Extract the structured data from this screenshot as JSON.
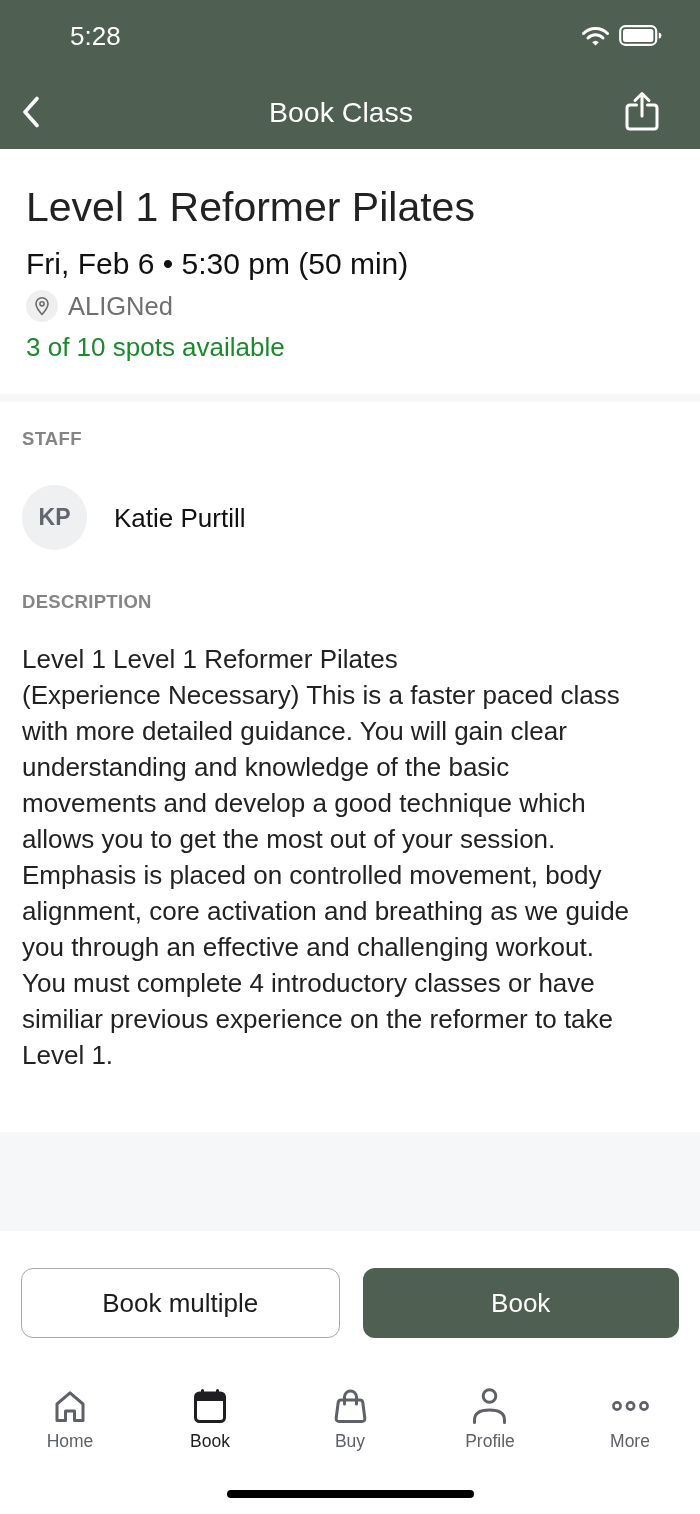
{
  "status_bar": {
    "time": "5:28"
  },
  "nav_bar": {
    "title": "Book Class"
  },
  "class_info": {
    "title": "Level 1 Reformer Pilates",
    "schedule": "Fri, Feb 6 • 5:30 pm (50 min)",
    "location": "ALIGNed",
    "availability": "3 of 10 spots available"
  },
  "staff": {
    "heading": "STAFF",
    "members": [
      {
        "initials": "KP",
        "name": "Katie Purtill"
      }
    ]
  },
  "description": {
    "heading": "DESCRIPTION",
    "text": "Level 1 Level 1 Reformer Pilates\n(Experience Necessary) This is a faster paced class with more detailed guidance. You will gain clear understanding and knowledge of the basic movements and develop a good technique which allows you to get the most out of your session. Emphasis is placed on controlled movement, body alignment, core activation and breathing as we guide you through an effective and challenging workout. You must complete 4 introductory classes or have similiar previous experience on the reformer to take Level 1."
  },
  "actions": [
    {
      "label": "Book multiple",
      "kind": "outline"
    },
    {
      "label": "Book",
      "kind": "primary"
    }
  ],
  "tab_bar": [
    {
      "label": "Home",
      "kind": "home",
      "selected": false
    },
    {
      "label": "Book",
      "kind": "calendar",
      "selected": true
    },
    {
      "label": "Buy",
      "kind": "bag",
      "selected": false
    },
    {
      "label": "Profile",
      "kind": "person",
      "selected": false
    },
    {
      "label": "More",
      "kind": "more",
      "selected": false
    }
  ]
}
